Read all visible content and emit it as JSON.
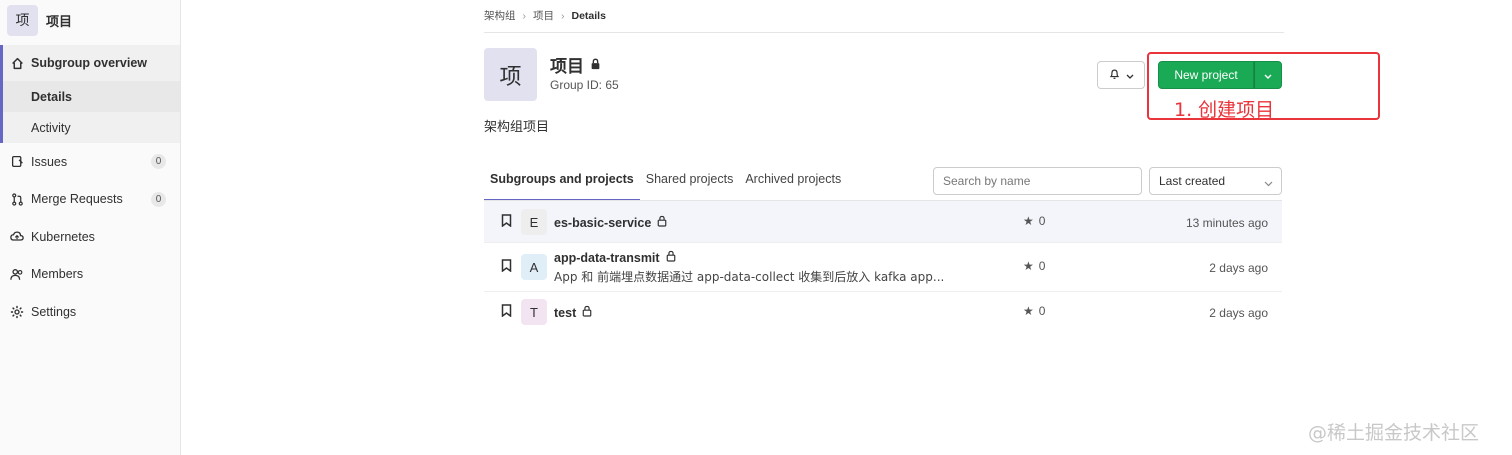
{
  "sidebar": {
    "avatar_letter": "项",
    "title": "项目",
    "overview_label": "Subgroup overview",
    "details_label": "Details",
    "activity_label": "Activity",
    "issues_label": "Issues",
    "issues_count": "0",
    "mr_label": "Merge Requests",
    "mr_count": "0",
    "kubernetes_label": "Kubernetes",
    "members_label": "Members",
    "settings_label": "Settings"
  },
  "breadcrumb": {
    "root": "架构组",
    "group": "项目",
    "current": "Details"
  },
  "group": {
    "avatar_letter": "项",
    "name": "项目",
    "group_id": "Group ID: 65",
    "description": "架构组项目"
  },
  "actions": {
    "new_project_label": "New project"
  },
  "annotation": {
    "text": "1. 创建项目",
    "color": "#e8343a"
  },
  "tabs": [
    {
      "label": "Subgroups and projects"
    },
    {
      "label": "Shared projects"
    },
    {
      "label": "Archived projects"
    }
  ],
  "search": {
    "placeholder": "Search by name"
  },
  "sort": {
    "selected": "Last created"
  },
  "projects": [
    {
      "letter": "E",
      "name": "es-basic-service",
      "description": "",
      "stars": "0",
      "updated": "13 minutes ago",
      "avatar_color": "#eeeeee"
    },
    {
      "letter": "A",
      "name": "app-data-transmit",
      "description": "App 和 前端埋点数据通过 app-data-collect 收集到后放入 kafka app...",
      "stars": "0",
      "updated": "2 days ago",
      "avatar_color": "#e0eef8"
    },
    {
      "letter": "T",
      "name": "test",
      "description": "",
      "stars": "0",
      "updated": "2 days ago",
      "avatar_color": "#f3e4f2"
    }
  ],
  "watermark": "@稀土掘金技术社区",
  "colors": {
    "primary_green": "#1aaa55",
    "accent_purple": "#6666c4"
  }
}
